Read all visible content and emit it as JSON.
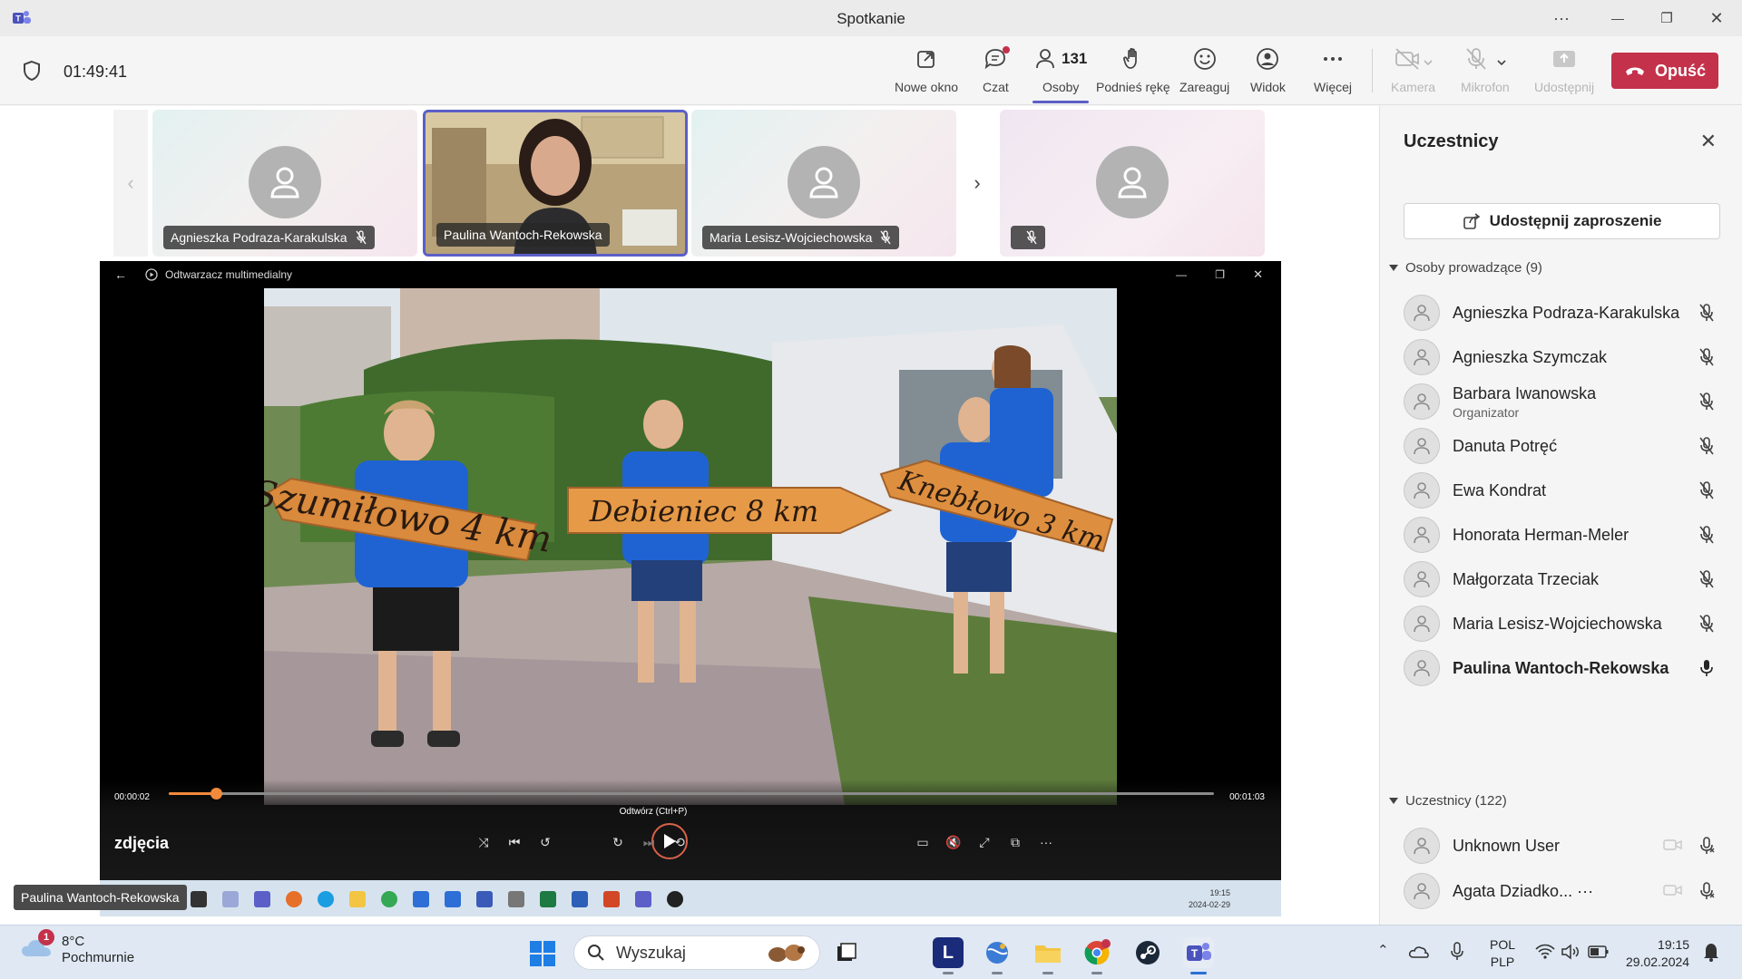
{
  "window": {
    "title": "Spotkanie",
    "more_glyph": "···",
    "minimize_glyph": "—",
    "restore_glyph": "❐",
    "close_glyph": "✕"
  },
  "toolbar": {
    "timer": "01:49:41",
    "new_window": "Nowe okno",
    "chat": "Czat",
    "people": "Osoby",
    "people_count": "131",
    "raise_hand": "Podnieś rękę",
    "react": "Zareaguj",
    "view": "Widok",
    "more": "Więcej",
    "camera": "Kamera",
    "mic": "Mikrofon",
    "share": "Udostępnij",
    "leave": "Opuść",
    "accent_color": "#5b5fc7",
    "leave_color": "#c4314b"
  },
  "stage": {
    "tiles": [
      {
        "name": "Agnieszka Podraza-Karakulska",
        "muted": true
      },
      {
        "name": "Paulina Wantoch-Rekowska",
        "muted": false,
        "video": true
      },
      {
        "name": "Maria Lesisz-Wojciechowska",
        "muted": true
      },
      {
        "name": "",
        "muted": true
      }
    ],
    "speaker_tag": "Paulina Wantoch-Rekowska"
  },
  "player": {
    "app_title": "Odtwarzacz multimedialny",
    "time_elapsed": "00:00:02",
    "time_total": "00:01:03",
    "progress": 0.045,
    "media_title": "zdjęcia",
    "tooltip": "Odtwórz (Ctrl+P)",
    "sign1": "Szumiłowo 4 km",
    "sign2": "Debieniec 8 km",
    "sign3": "Knebłowo 3 km",
    "inner_time": "19:15",
    "inner_date": "2024-02-29"
  },
  "panel": {
    "title": "Uczestnicy",
    "invite": "Udostępnij zaproszenie",
    "presenters_section": "Osoby prowadzące (9)",
    "attendees_section": "Uczestnicy (122)",
    "presenters": [
      {
        "name": "Agnieszka Podraza-Karakulska",
        "role": "",
        "muted": true
      },
      {
        "name": "Agnieszka Szymczak",
        "role": "",
        "muted": true
      },
      {
        "name": "Barbara Iwanowska",
        "role": "Organizator",
        "muted": true
      },
      {
        "name": "Danuta Potręć",
        "role": "",
        "muted": true
      },
      {
        "name": "Ewa Kondrat",
        "role": "",
        "muted": true
      },
      {
        "name": "Honorata Herman-Meler",
        "role": "",
        "muted": true
      },
      {
        "name": "Małgorzata Trzeciak",
        "role": "",
        "muted": true
      },
      {
        "name": "Maria Lesisz-Wojciechowska",
        "role": "",
        "muted": true
      },
      {
        "name": "Paulina Wantoch-Rekowska",
        "role": "",
        "muted": false
      }
    ],
    "attendees": [
      {
        "name": "Unknown User"
      },
      {
        "name": "Agata Dziadko... ···"
      }
    ]
  },
  "taskbar": {
    "weather_badge": "1",
    "temperature": "8°C",
    "weather_desc": "Pochmurnie",
    "search_placeholder": "Wyszukaj",
    "lang1": "POL",
    "lang2": "PLP",
    "time": "19:15",
    "date": "29.02.2024",
    "l_app_letter": "L"
  }
}
